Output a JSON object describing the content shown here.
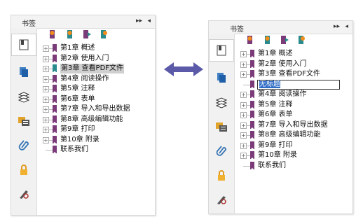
{
  "left_panel": {
    "title": "书签",
    "controls": {
      "expand": "▸▸",
      "collapse": "◂"
    },
    "tree": [
      {
        "label": "第1章 概述",
        "expandable": true,
        "selected": false,
        "color": "#7b3b79"
      },
      {
        "label": "第2章 使用入门",
        "expandable": true,
        "selected": false,
        "color": "#7b3b79"
      },
      {
        "label": "第3章 查看PDF文件",
        "expandable": true,
        "selected": true,
        "color": "#2a8a8c"
      },
      {
        "label": "第4章 阅读操作",
        "expandable": true,
        "selected": false,
        "color": "#7b3b79"
      },
      {
        "label": "第5章 注释",
        "expandable": true,
        "selected": false,
        "color": "#7b3b79"
      },
      {
        "label": "第6章 表单",
        "expandable": true,
        "selected": false,
        "color": "#7b3b79"
      },
      {
        "label": "第7章 导入和导出数据",
        "expandable": true,
        "selected": false,
        "color": "#7b3b79"
      },
      {
        "label": "第8章 高级编辑功能",
        "expandable": true,
        "selected": false,
        "color": "#7b3b79"
      },
      {
        "label": "第9章 打印",
        "expandable": true,
        "selected": false,
        "color": "#7b3b79"
      },
      {
        "label": "第10章 附录",
        "expandable": true,
        "selected": false,
        "color": "#7b3b79"
      },
      {
        "label": "联系我们",
        "expandable": false,
        "selected": false,
        "color": "#7b3b79"
      }
    ]
  },
  "right_panel": {
    "title": "书签",
    "controls": {
      "expand": "▸▸",
      "collapse": "◂"
    },
    "tree": [
      {
        "label": "第1章 概述",
        "expandable": true
      },
      {
        "label": "第2章 使用入门",
        "expandable": true
      },
      {
        "label": "第3章 查看PDF文件",
        "expandable": true
      },
      {
        "edit_value": "无标题"
      },
      {
        "label": "第4章 阅读操作",
        "expandable": true
      },
      {
        "label": "第5章 注释",
        "expandable": true
      },
      {
        "label": "第6章 表单",
        "expandable": true
      },
      {
        "label": "第7章 导入和导出数据",
        "expandable": true
      },
      {
        "label": "第8章 高级编辑功能",
        "expandable": true
      },
      {
        "label": "第9章 打印",
        "expandable": true
      },
      {
        "label": "第10章 附录",
        "expandable": true
      },
      {
        "label": "联系我们",
        "expandable": false
      }
    ]
  },
  "sidebar_icons": [
    "pages-icon",
    "layers-icon",
    "comments-icon",
    "attachment-icon",
    "lock-icon",
    "sign-icon"
  ],
  "toolbar_icons": [
    "new-bookmark-icon",
    "delete-bookmark-icon",
    "expand-bookmark-icon",
    "bookmark-options-icon"
  ],
  "colors": {
    "accent_purple": "#7b3b79",
    "accent_teal": "#2a8a8c",
    "arrow": "#5b5aa8",
    "edit_highlight": "#2f6cc6"
  }
}
